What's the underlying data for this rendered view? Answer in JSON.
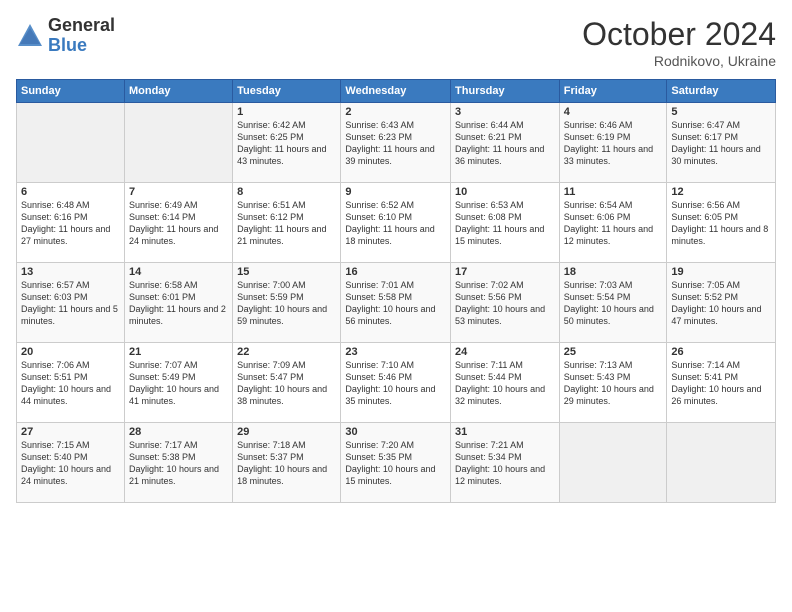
{
  "header": {
    "logo_general": "General",
    "logo_blue": "Blue",
    "month_title": "October 2024",
    "location": "Rodnikovo, Ukraine"
  },
  "days_of_week": [
    "Sunday",
    "Monday",
    "Tuesday",
    "Wednesday",
    "Thursday",
    "Friday",
    "Saturday"
  ],
  "weeks": [
    [
      {
        "day": "",
        "sunrise": "",
        "sunset": "",
        "daylight": ""
      },
      {
        "day": "",
        "sunrise": "",
        "sunset": "",
        "daylight": ""
      },
      {
        "day": "1",
        "sunrise": "Sunrise: 6:42 AM",
        "sunset": "Sunset: 6:25 PM",
        "daylight": "Daylight: 11 hours and 43 minutes."
      },
      {
        "day": "2",
        "sunrise": "Sunrise: 6:43 AM",
        "sunset": "Sunset: 6:23 PM",
        "daylight": "Daylight: 11 hours and 39 minutes."
      },
      {
        "day": "3",
        "sunrise": "Sunrise: 6:44 AM",
        "sunset": "Sunset: 6:21 PM",
        "daylight": "Daylight: 11 hours and 36 minutes."
      },
      {
        "day": "4",
        "sunrise": "Sunrise: 6:46 AM",
        "sunset": "Sunset: 6:19 PM",
        "daylight": "Daylight: 11 hours and 33 minutes."
      },
      {
        "day": "5",
        "sunrise": "Sunrise: 6:47 AM",
        "sunset": "Sunset: 6:17 PM",
        "daylight": "Daylight: 11 hours and 30 minutes."
      }
    ],
    [
      {
        "day": "6",
        "sunrise": "Sunrise: 6:48 AM",
        "sunset": "Sunset: 6:16 PM",
        "daylight": "Daylight: 11 hours and 27 minutes."
      },
      {
        "day": "7",
        "sunrise": "Sunrise: 6:49 AM",
        "sunset": "Sunset: 6:14 PM",
        "daylight": "Daylight: 11 hours and 24 minutes."
      },
      {
        "day": "8",
        "sunrise": "Sunrise: 6:51 AM",
        "sunset": "Sunset: 6:12 PM",
        "daylight": "Daylight: 11 hours and 21 minutes."
      },
      {
        "day": "9",
        "sunrise": "Sunrise: 6:52 AM",
        "sunset": "Sunset: 6:10 PM",
        "daylight": "Daylight: 11 hours and 18 minutes."
      },
      {
        "day": "10",
        "sunrise": "Sunrise: 6:53 AM",
        "sunset": "Sunset: 6:08 PM",
        "daylight": "Daylight: 11 hours and 15 minutes."
      },
      {
        "day": "11",
        "sunrise": "Sunrise: 6:54 AM",
        "sunset": "Sunset: 6:06 PM",
        "daylight": "Daylight: 11 hours and 12 minutes."
      },
      {
        "day": "12",
        "sunrise": "Sunrise: 6:56 AM",
        "sunset": "Sunset: 6:05 PM",
        "daylight": "Daylight: 11 hours and 8 minutes."
      }
    ],
    [
      {
        "day": "13",
        "sunrise": "Sunrise: 6:57 AM",
        "sunset": "Sunset: 6:03 PM",
        "daylight": "Daylight: 11 hours and 5 minutes."
      },
      {
        "day": "14",
        "sunrise": "Sunrise: 6:58 AM",
        "sunset": "Sunset: 6:01 PM",
        "daylight": "Daylight: 11 hours and 2 minutes."
      },
      {
        "day": "15",
        "sunrise": "Sunrise: 7:00 AM",
        "sunset": "Sunset: 5:59 PM",
        "daylight": "Daylight: 10 hours and 59 minutes."
      },
      {
        "day": "16",
        "sunrise": "Sunrise: 7:01 AM",
        "sunset": "Sunset: 5:58 PM",
        "daylight": "Daylight: 10 hours and 56 minutes."
      },
      {
        "day": "17",
        "sunrise": "Sunrise: 7:02 AM",
        "sunset": "Sunset: 5:56 PM",
        "daylight": "Daylight: 10 hours and 53 minutes."
      },
      {
        "day": "18",
        "sunrise": "Sunrise: 7:03 AM",
        "sunset": "Sunset: 5:54 PM",
        "daylight": "Daylight: 10 hours and 50 minutes."
      },
      {
        "day": "19",
        "sunrise": "Sunrise: 7:05 AM",
        "sunset": "Sunset: 5:52 PM",
        "daylight": "Daylight: 10 hours and 47 minutes."
      }
    ],
    [
      {
        "day": "20",
        "sunrise": "Sunrise: 7:06 AM",
        "sunset": "Sunset: 5:51 PM",
        "daylight": "Daylight: 10 hours and 44 minutes."
      },
      {
        "day": "21",
        "sunrise": "Sunrise: 7:07 AM",
        "sunset": "Sunset: 5:49 PM",
        "daylight": "Daylight: 10 hours and 41 minutes."
      },
      {
        "day": "22",
        "sunrise": "Sunrise: 7:09 AM",
        "sunset": "Sunset: 5:47 PM",
        "daylight": "Daylight: 10 hours and 38 minutes."
      },
      {
        "day": "23",
        "sunrise": "Sunrise: 7:10 AM",
        "sunset": "Sunset: 5:46 PM",
        "daylight": "Daylight: 10 hours and 35 minutes."
      },
      {
        "day": "24",
        "sunrise": "Sunrise: 7:11 AM",
        "sunset": "Sunset: 5:44 PM",
        "daylight": "Daylight: 10 hours and 32 minutes."
      },
      {
        "day": "25",
        "sunrise": "Sunrise: 7:13 AM",
        "sunset": "Sunset: 5:43 PM",
        "daylight": "Daylight: 10 hours and 29 minutes."
      },
      {
        "day": "26",
        "sunrise": "Sunrise: 7:14 AM",
        "sunset": "Sunset: 5:41 PM",
        "daylight": "Daylight: 10 hours and 26 minutes."
      }
    ],
    [
      {
        "day": "27",
        "sunrise": "Sunrise: 7:15 AM",
        "sunset": "Sunset: 5:40 PM",
        "daylight": "Daylight: 10 hours and 24 minutes."
      },
      {
        "day": "28",
        "sunrise": "Sunrise: 7:17 AM",
        "sunset": "Sunset: 5:38 PM",
        "daylight": "Daylight: 10 hours and 21 minutes."
      },
      {
        "day": "29",
        "sunrise": "Sunrise: 7:18 AM",
        "sunset": "Sunset: 5:37 PM",
        "daylight": "Daylight: 10 hours and 18 minutes."
      },
      {
        "day": "30",
        "sunrise": "Sunrise: 7:20 AM",
        "sunset": "Sunset: 5:35 PM",
        "daylight": "Daylight: 10 hours and 15 minutes."
      },
      {
        "day": "31",
        "sunrise": "Sunrise: 7:21 AM",
        "sunset": "Sunset: 5:34 PM",
        "daylight": "Daylight: 10 hours and 12 minutes."
      },
      {
        "day": "",
        "sunrise": "",
        "sunset": "",
        "daylight": ""
      },
      {
        "day": "",
        "sunrise": "",
        "sunset": "",
        "daylight": ""
      }
    ]
  ]
}
